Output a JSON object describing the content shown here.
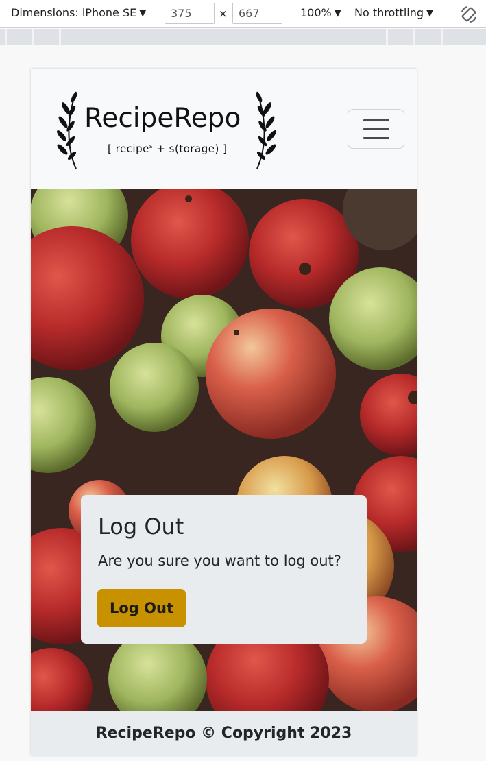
{
  "devtools": {
    "dimensions_label": "Dimensions: iPhone SE",
    "width_value": "375",
    "height_value": "667",
    "times_symbol": "×",
    "zoom": "100%",
    "throttling": "No throttling",
    "rotate_icon": "rotate-device-icon"
  },
  "navbar": {
    "brand": "RecipeRepo",
    "tagline_pre": "[ recipe",
    "tagline_sup": "s",
    "tagline_post": " + s(torage) ]",
    "menu_icon": "hamburger-icon"
  },
  "logout_card": {
    "title": "Log Out",
    "message": "Are you sure you want to log out?",
    "button_label": "Log Out"
  },
  "footer": {
    "text": "RecipeRepo © Copyright 2023"
  },
  "colors": {
    "button": "#c79100",
    "card_bg": "#e9ecef",
    "navbar_bg": "#f8f9fa"
  }
}
